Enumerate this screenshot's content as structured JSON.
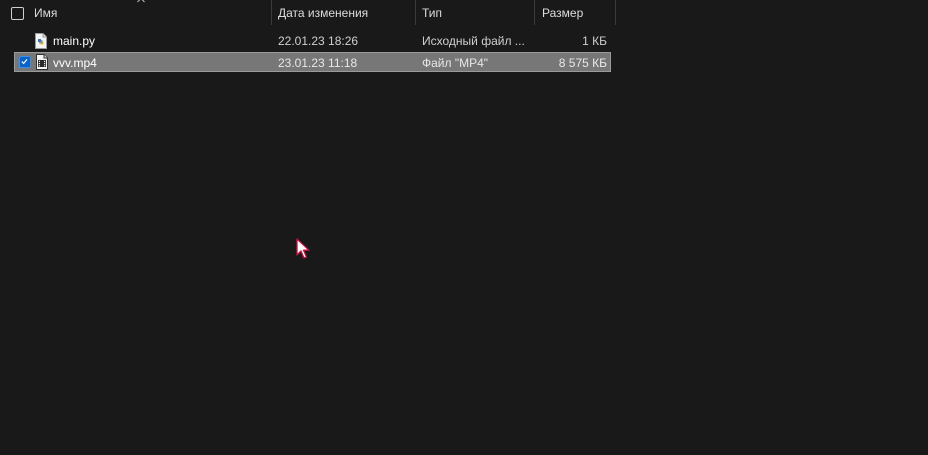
{
  "header": {
    "name": "Имя",
    "date_modified": "Дата изменения",
    "type": "Тип",
    "size": "Размер",
    "sort_column": "name",
    "sort_direction": "ascending"
  },
  "files": [
    {
      "name": "main.py",
      "date_modified": "22.01.23 18:26",
      "type": "Исходный файл ...",
      "size": "1 КБ",
      "icon": "python-file-icon",
      "selected": false
    },
    {
      "name": "vvv.mp4",
      "date_modified": "23.01.23 11:18",
      "type": "Файл \"MP4\"",
      "size": "8 575 КБ",
      "icon": "video-file-icon",
      "selected": true
    }
  ],
  "colors": {
    "background": "#191919",
    "selection": "#777777",
    "checkbox_accent": "#0a64c8",
    "cursor": "#c0143c"
  }
}
